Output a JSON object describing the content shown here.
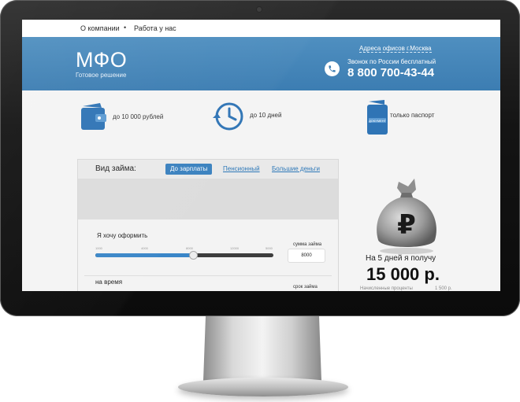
{
  "nav": {
    "about": "О компании",
    "separator": "•",
    "careers": "Работа у нас"
  },
  "header": {
    "logo": "МФО",
    "tagline": "Готовое решение",
    "offices_link": "Адреса офисов г.Москва",
    "call_note": "Звонок по России бесплатный",
    "phone": "8 800 700-43-44"
  },
  "features": [
    {
      "icon": "wallet-icon",
      "text": "до 10 000 рублей"
    },
    {
      "icon": "clock-icon",
      "text": "до 10 дней"
    },
    {
      "icon": "passport-icon",
      "text": "только паспорт",
      "icon_caption": "ДОКУМЕНТ"
    }
  ],
  "loan_form": {
    "title": "Вид займа:",
    "tabs": [
      {
        "label": "До зарплаты",
        "active": true
      },
      {
        "label": "Пенсионный",
        "active": false
      },
      {
        "label": "Большие деньги",
        "active": false
      }
    ],
    "amount_label": "Я хочу оформить",
    "slider_ticks": [
      "1000",
      "4000",
      "8000",
      "12000",
      "5000"
    ],
    "slider_value_fraction": 0.55,
    "sum_label": "сумма займа",
    "sum_value": "8000",
    "term_label": "на время",
    "term_caption": "срок займа"
  },
  "promo": {
    "bag_symbol": "₽",
    "line1": "На 5 дней я получу",
    "amount": "15 000 р.",
    "accrued_label": "Начисленные проценты",
    "accrued_value": "1 500 р."
  },
  "colors": {
    "brand_blue": "#3c7db2",
    "header_light": "#4f8fc0",
    "icon_blue": "#2f74b5"
  }
}
